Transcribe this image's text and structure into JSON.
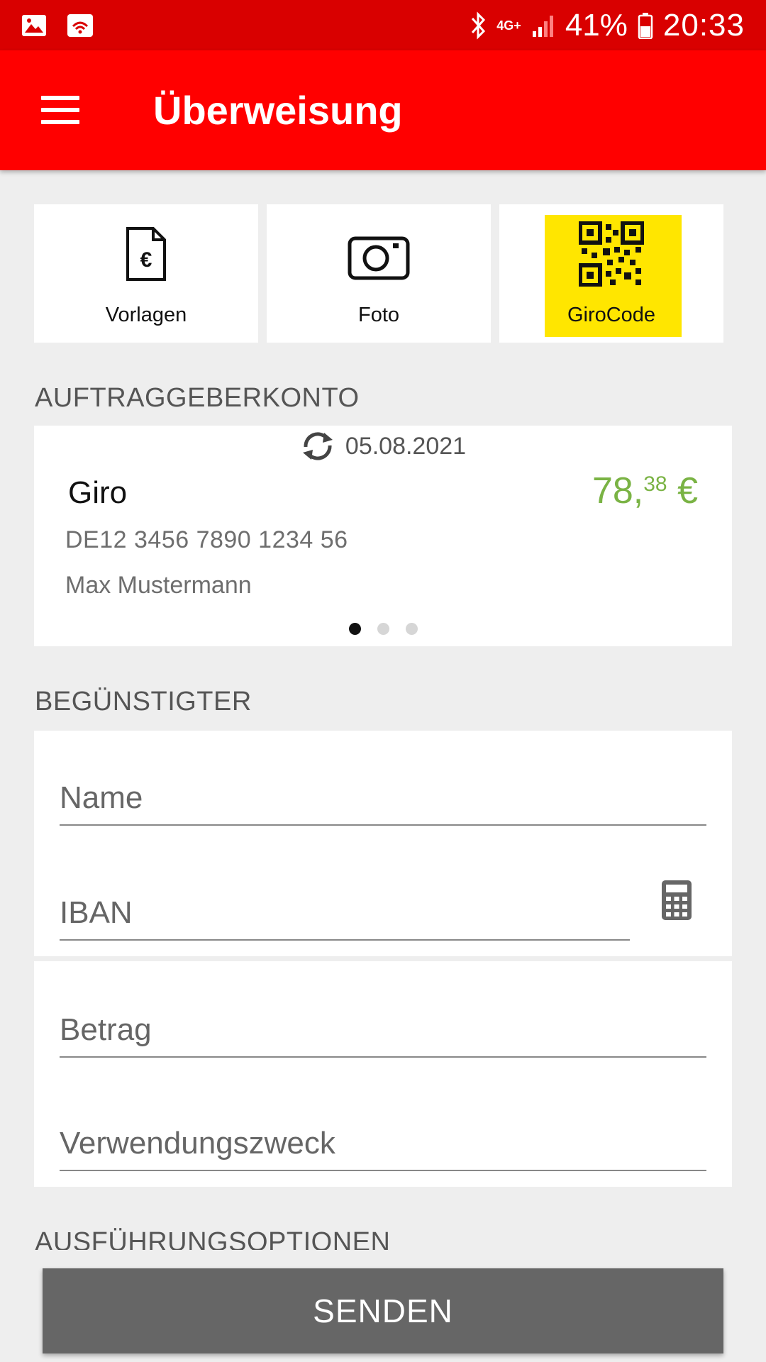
{
  "status_bar": {
    "network": "4G+",
    "battery": "41%",
    "time": "20:33",
    "icons": [
      "image-icon",
      "wifi-calling-icon",
      "bluetooth-icon",
      "signal-icon",
      "battery-icon"
    ]
  },
  "app_bar": {
    "title": "Überweisung",
    "menu_icon": "hamburger-menu-icon"
  },
  "quick_actions": [
    {
      "label": "Vorlagen",
      "icon": "euro-document-icon"
    },
    {
      "label": "Foto",
      "icon": "camera-icon"
    },
    {
      "label": "GiroCode",
      "icon": "qr-code-icon",
      "highlight": "#ffe600"
    }
  ],
  "payer_section": {
    "heading": "AUFTRAGGEBERKONTO",
    "account": {
      "sync_date": "05.08.2021",
      "name": "Giro",
      "balance_main": "78,",
      "balance_cents": "38",
      "currency": "€",
      "iban": "DE12 3456 7890 1234 56",
      "holder": "Max Mustermann"
    },
    "pager": {
      "count": 3,
      "active": 1
    }
  },
  "beneficiary_section": {
    "heading": "BEGÜNSTIGTER",
    "name_placeholder": "Name",
    "iban_placeholder": "IBAN"
  },
  "payment_section": {
    "amount_placeholder": "Betrag",
    "purpose_placeholder": "Verwendungszweck"
  },
  "options_heading": "AUSFÜHRUNGSOPTIONEN",
  "send_label": "SENDEN",
  "colors": {
    "status_bar": "#d90000",
    "app_bar": "#ff0000",
    "balance": "#7ab344",
    "girocode_highlight": "#ffe600",
    "send_button": "#666666"
  }
}
